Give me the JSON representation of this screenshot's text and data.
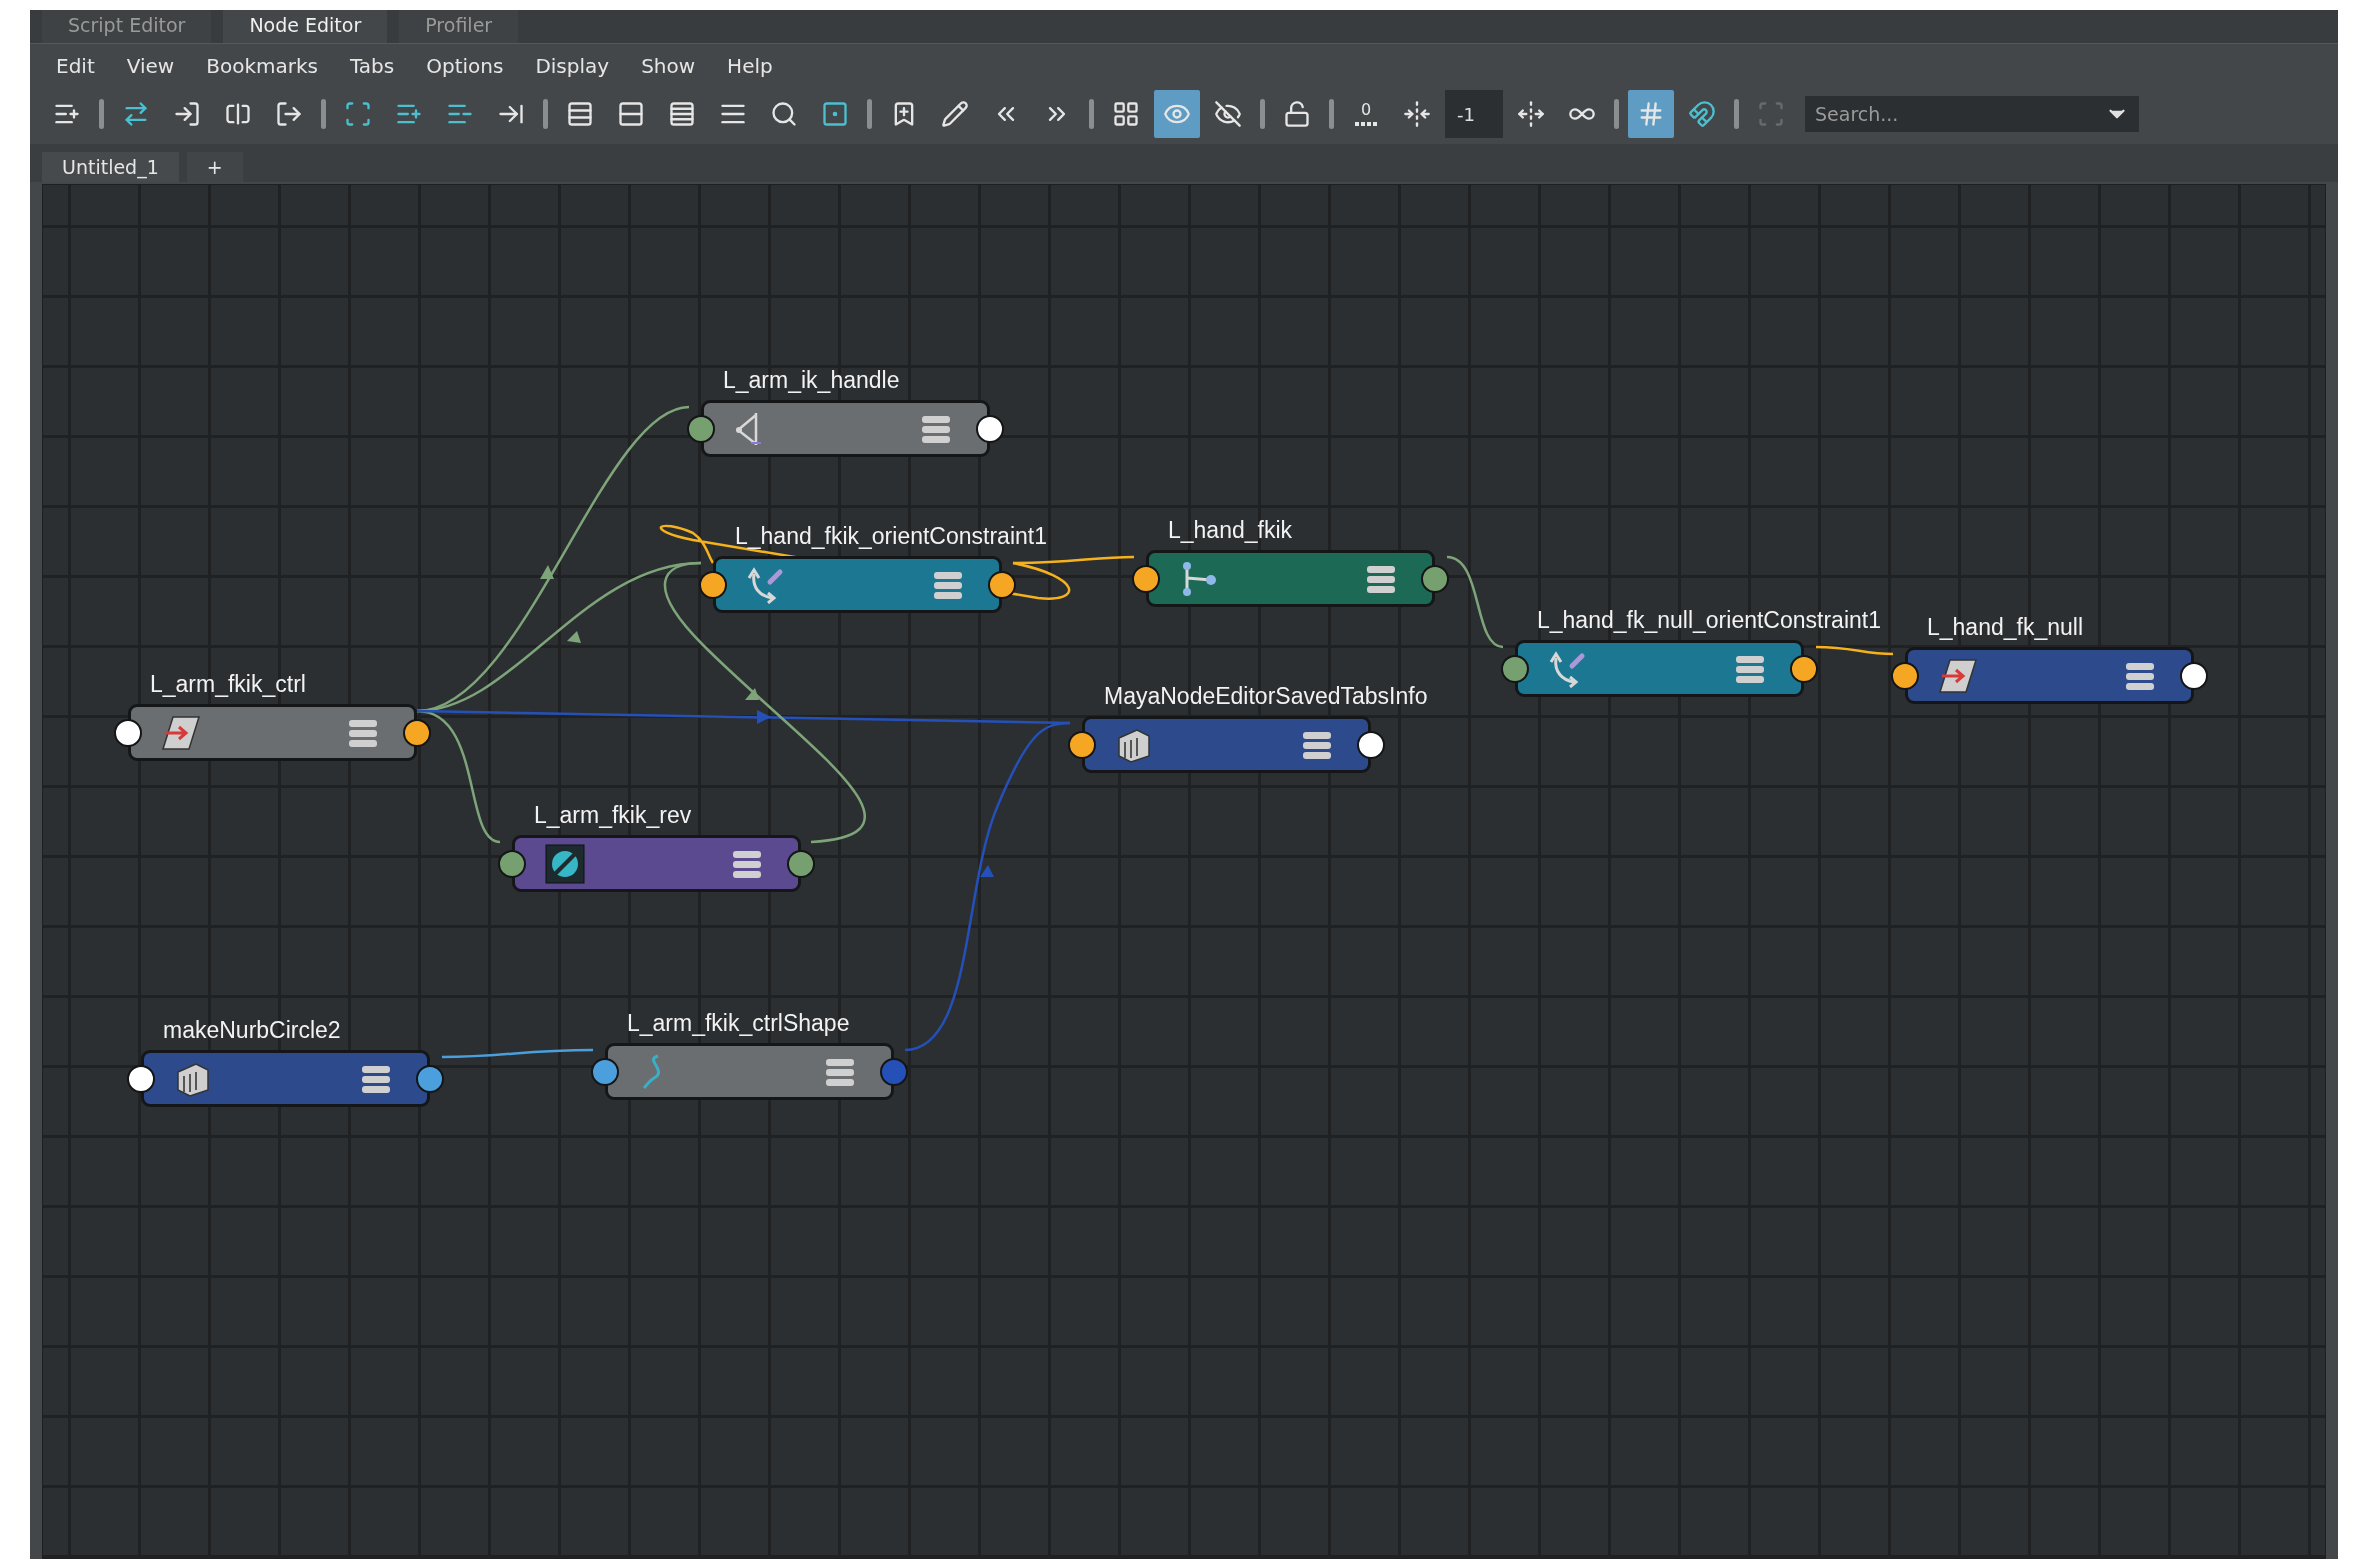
{
  "tabs": [
    {
      "label": "Script Editor",
      "selected": false
    },
    {
      "label": "Node Editor",
      "selected": true
    },
    {
      "label": "Profiler",
      "selected": false
    }
  ],
  "menu": [
    "Edit",
    "View",
    "Bookmarks",
    "Tabs",
    "Options",
    "Display",
    "Show",
    "Help"
  ],
  "toolbar": [
    {
      "kind": "button",
      "on": false,
      "disabled": false
    },
    {
      "kind": "separator"
    },
    {
      "kind": "button",
      "on": false,
      "disabled": false
    },
    {
      "kind": "button",
      "on": false,
      "disabled": false
    },
    {
      "kind": "button",
      "on": false,
      "disabled": false
    },
    {
      "kind": "button",
      "on": false,
      "disabled": false
    },
    {
      "kind": "separator"
    },
    {
      "kind": "button",
      "on": false,
      "disabled": false
    },
    {
      "kind": "button",
      "on": false,
      "disabled": false
    },
    {
      "kind": "button",
      "on": false,
      "disabled": false
    },
    {
      "kind": "button",
      "on": false,
      "disabled": false
    },
    {
      "kind": "separator"
    },
    {
      "kind": "button",
      "on": false,
      "disabled": false
    },
    {
      "kind": "button",
      "on": false,
      "disabled": false
    },
    {
      "kind": "button",
      "on": false,
      "disabled": false
    },
    {
      "kind": "button",
      "on": false,
      "disabled": false
    },
    {
      "kind": "button",
      "on": false,
      "disabled": false
    },
    {
      "kind": "button",
      "on": false,
      "disabled": false
    },
    {
      "kind": "separator"
    },
    {
      "kind": "button",
      "on": false,
      "disabled": false
    },
    {
      "kind": "button",
      "on": false,
      "disabled": false
    },
    {
      "kind": "button",
      "on": false,
      "disabled": false
    },
    {
      "kind": "button",
      "on": false,
      "disabled": false
    },
    {
      "kind": "separator"
    },
    {
      "kind": "button",
      "on": false,
      "disabled": false
    },
    {
      "kind": "button",
      "on": true,
      "disabled": false
    },
    {
      "kind": "button",
      "on": false,
      "disabled": false
    },
    {
      "kind": "separator"
    },
    {
      "kind": "button",
      "on": false,
      "disabled": false
    },
    {
      "kind": "separator"
    },
    {
      "kind": "button",
      "label": "0",
      "on": false,
      "disabled": false
    },
    {
      "kind": "button",
      "on": false,
      "disabled": false
    },
    {
      "kind": "field",
      "value": "-1"
    },
    {
      "kind": "button",
      "on": false,
      "disabled": false
    },
    {
      "kind": "button",
      "on": false,
      "disabled": false
    },
    {
      "kind": "separator"
    },
    {
      "kind": "button",
      "on": true,
      "disabled": false
    },
    {
      "kind": "button",
      "on": false,
      "disabled": false
    },
    {
      "kind": "separator"
    },
    {
      "kind": "button",
      "on": false,
      "disabled": true
    },
    {
      "kind": "search",
      "placeholder": "Search..."
    }
  ],
  "editor_tabs": [
    {
      "label": "Untitled_1",
      "selected": true
    }
  ],
  "add_tab": "+",
  "nodes": [
    {
      "name": "L_arm_ik_handle",
      "kind": "ikHandle",
      "input_port": {
        "color": "#76a070"
      },
      "output_port": {
        "color": "#ffffff"
      }
    },
    {
      "name": "L_hand_fkik_orientConstraint1",
      "kind": "constraint",
      "input_port": {
        "color": "#f5a623"
      },
      "output_port": {
        "color": "#f5a623"
      }
    },
    {
      "name": "L_hand_fkik",
      "kind": "joint",
      "input_port": {
        "color": "#f5a623"
      },
      "output_port": {
        "color": "#76a070"
      }
    },
    {
      "name": "L_hand_fk_null_orientConstraint1",
      "kind": "constraint",
      "input_port": {
        "color": "#76a070"
      },
      "output_port": {
        "color": "#f5a623"
      }
    },
    {
      "name": "L_hand_fk_null",
      "kind": "transform",
      "input_port": {
        "color": "#f5a623"
      },
      "output_port": {
        "color": "#ffffff"
      }
    },
    {
      "name": "L_arm_fkik_ctrl",
      "kind": "control",
      "input_port": {
        "color": "#ffffff"
      },
      "output_port": {
        "color": "#f5a623"
      }
    },
    {
      "name": "MayaNodeEditorSavedTabsInfo",
      "kind": "network",
      "input_port": {
        "color": "#f5a623"
      },
      "output_port": {
        "color": "#ffffff"
      }
    },
    {
      "name": "L_arm_fkik_rev",
      "kind": "reverse",
      "input_port": {
        "color": "#76a070"
      },
      "output_port": {
        "color": "#76a070"
      }
    },
    {
      "name": "makeNurbCircle2",
      "kind": "network",
      "input_port": {
        "color": "#ffffff"
      },
      "output_port": {
        "color": "#4a9fdc"
      }
    },
    {
      "name": "L_arm_fkik_ctrlShape",
      "kind": "shape",
      "input_port": {
        "color": "#4a9fdc"
      },
      "output_port": {
        "color": "#2450b8"
      }
    }
  ]
}
